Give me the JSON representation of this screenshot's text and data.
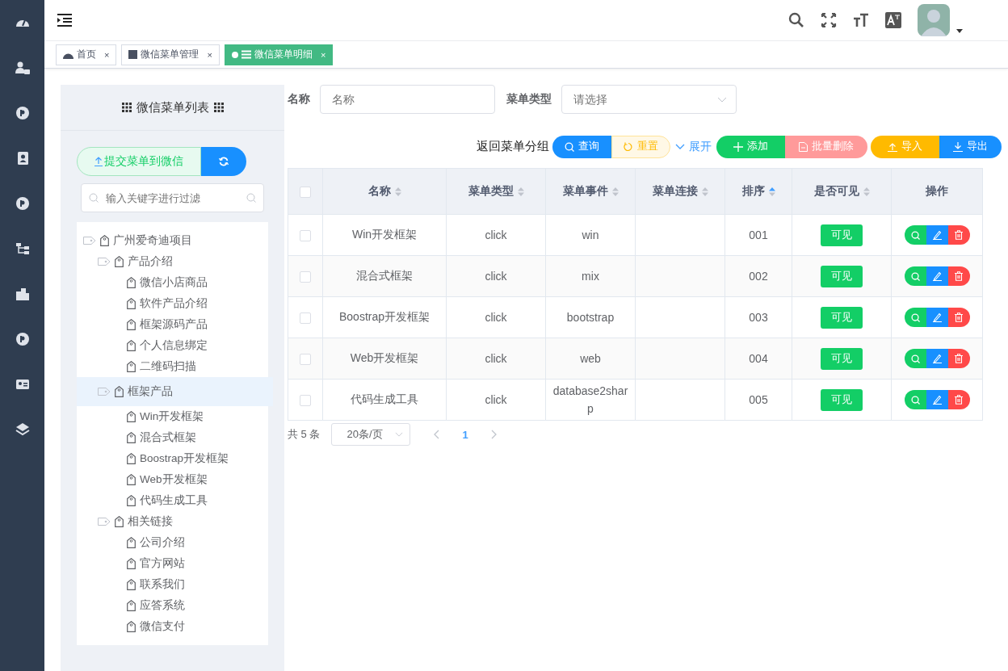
{
  "tabs": [
    {
      "label": "首页",
      "kind": "home",
      "close": "×",
      "selected": false
    },
    {
      "label": "微信菜单管理",
      "kind": "page",
      "close": "×",
      "selected": false
    },
    {
      "label": "微信菜单明细",
      "kind": "list",
      "close": "×",
      "selected": true
    }
  ],
  "tree_panel": {
    "title": "微信菜单列表",
    "submit_button": "提交菜单到微信",
    "filter": {
      "placeholder": "输入关键字进行过滤"
    },
    "nodes": [
      {
        "label": "广州爱奇迪项目",
        "selected": false,
        "children": [
          {
            "label": "产品介绍",
            "selected": false,
            "children": [
              {
                "label": "微信小店商品",
                "selected": false
              },
              {
                "label": "软件产品介绍",
                "selected": false
              },
              {
                "label": "框架源码产品",
                "selected": false
              },
              {
                "label": "个人信息绑定",
                "selected": false
              },
              {
                "label": "二维码扫描",
                "selected": false
              }
            ]
          },
          {
            "label": "框架产品",
            "selected": true,
            "children": [
              {
                "label": "Win开发框架",
                "selected": false
              },
              {
                "label": "混合式框架",
                "selected": false
              },
              {
                "label": "Boostrap开发框架",
                "selected": false
              },
              {
                "label": "Web开发框架",
                "selected": false
              },
              {
                "label": "代码生成工具",
                "selected": false
              }
            ]
          },
          {
            "label": "相关链接",
            "selected": false,
            "children": [
              {
                "label": "公司介绍",
                "selected": false
              },
              {
                "label": "官方网站",
                "selected": false
              },
              {
                "label": "联系我们",
                "selected": false
              },
              {
                "label": "应答系统",
                "selected": false
              },
              {
                "label": "微信支付",
                "selected": false
              }
            ]
          }
        ]
      }
    ]
  },
  "search_form": {
    "name_label": "名称",
    "name_placeholder": "名称",
    "type_label": "菜单类型",
    "type_placeholder": "请选择"
  },
  "toolbar": {
    "back_label": "返回菜单分组",
    "expand_label": "展开",
    "buttons": [
      {
        "kind": "query",
        "label": "查询"
      },
      {
        "kind": "reset",
        "label": "重置"
      },
      {
        "kind": "add",
        "label": "添加"
      },
      {
        "kind": "batch-delete",
        "label": "批量删除"
      },
      {
        "kind": "import",
        "label": "导入"
      },
      {
        "kind": "export",
        "label": "导出"
      }
    ]
  },
  "table": {
    "all_checked": false,
    "columns": [
      {
        "label": "名称",
        "sorted": false
      },
      {
        "label": "菜单类型",
        "sorted": false
      },
      {
        "label": "菜单事件",
        "sorted": false
      },
      {
        "label": "菜单连接",
        "sorted": false
      },
      {
        "label": "排序",
        "sorted": true
      },
      {
        "label": "是否可见",
        "sorted": false
      },
      {
        "label": "操作"
      }
    ],
    "rows": [
      {
        "checked": false,
        "name": "Win开发框架",
        "type": "click",
        "event": "win",
        "order": "001",
        "visible": "可见"
      },
      {
        "checked": false,
        "name": "混合式框架",
        "type": "click",
        "event": "mix",
        "order": "002",
        "visible": "可见"
      },
      {
        "checked": false,
        "name": "Boostrap开发框架",
        "type": "click",
        "event": "bootstrap",
        "order": "003",
        "visible": "可见"
      },
      {
        "checked": false,
        "name": "Web开发框架",
        "type": "click",
        "event": "web",
        "order": "004",
        "visible": "可见"
      },
      {
        "checked": false,
        "name": "代码生成工具",
        "type": "click",
        "event": "database2sharp",
        "order": "005",
        "visible": "可见"
      }
    ]
  },
  "pagination": {
    "total": "共 5 条",
    "page_size": "20条/页",
    "pages": [
      {
        "label": "1",
        "selected": true
      }
    ]
  }
}
